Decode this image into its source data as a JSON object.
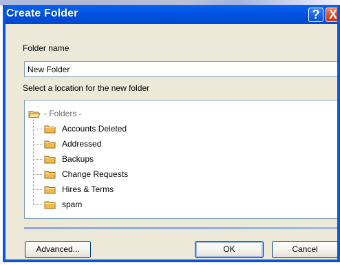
{
  "dialog": {
    "title": "Create Folder",
    "help_button_label": "?",
    "close_button_label": "X"
  },
  "folder_name": {
    "label": "Folder name",
    "value": "New Folder"
  },
  "location": {
    "label": "Select a location for the new folder",
    "root_label": "- Folders -",
    "folders": [
      "Accounts Deleted",
      "Addressed",
      "Backups",
      "Change Requests",
      "Hires & Terms",
      "spam"
    ]
  },
  "buttons": {
    "advanced_label": "Advanced...",
    "ok_label": "OK",
    "cancel_label": "Cancel"
  },
  "colors": {
    "title_bar": "#0055e5",
    "dialog_background": "#ece9d8",
    "folder_icon": "#f7c35a"
  }
}
